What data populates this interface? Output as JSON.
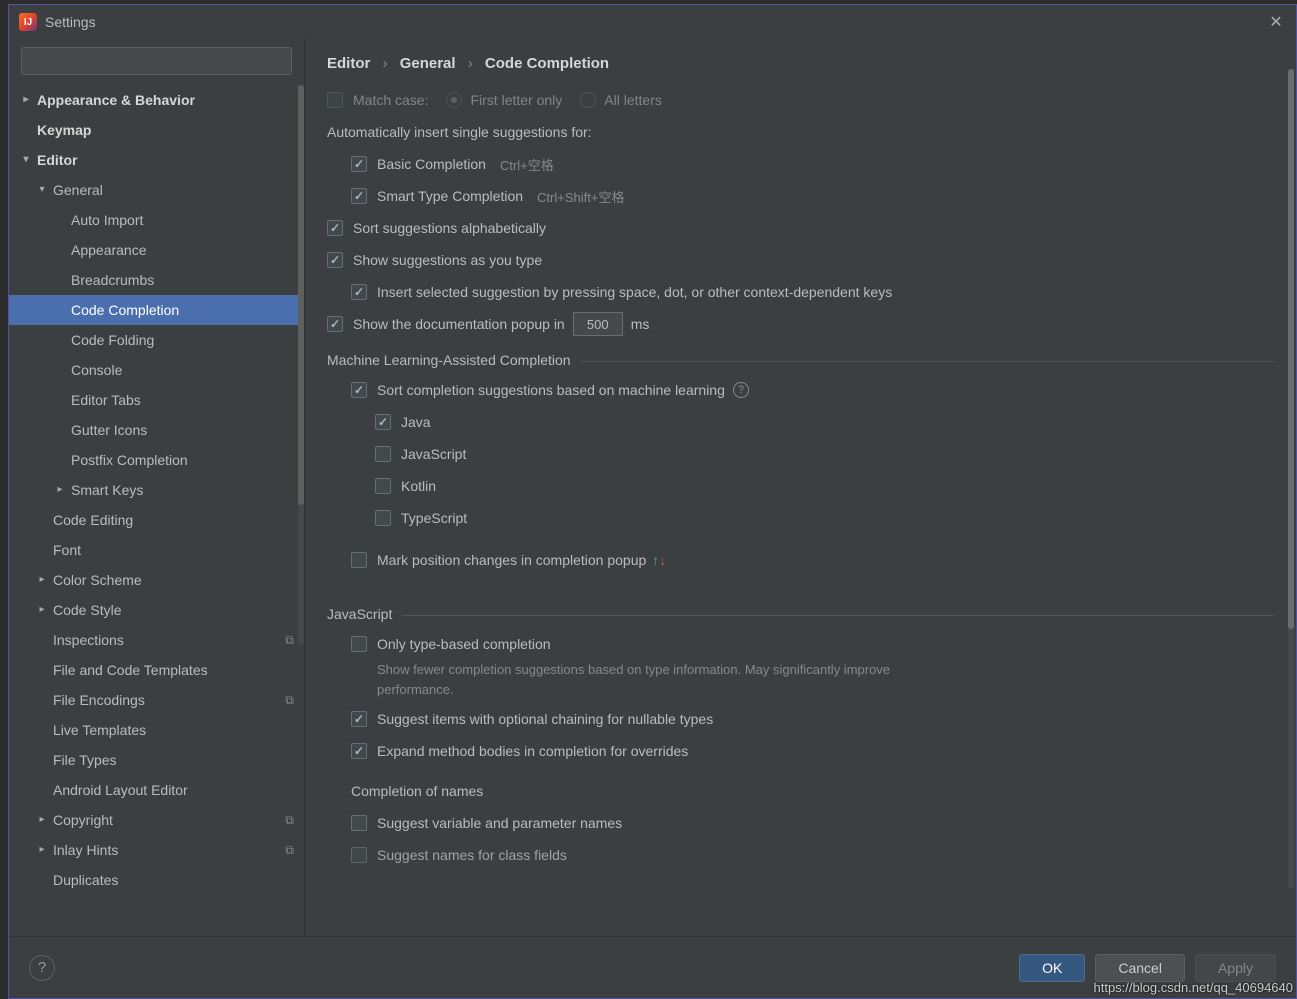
{
  "window": {
    "title": "Settings"
  },
  "breadcrumb": {
    "a": "Editor",
    "b": "General",
    "c": "Code Completion"
  },
  "sidebar": {
    "items": [
      {
        "label": "Appearance & Behavior",
        "bold": true,
        "chev": ">",
        "indent": 0
      },
      {
        "label": "Keymap",
        "bold": true,
        "indent": 0
      },
      {
        "label": "Editor",
        "bold": true,
        "chev": "v",
        "indent": 0
      },
      {
        "label": "General",
        "chev": "v",
        "indent": 1
      },
      {
        "label": "Auto Import",
        "indent": 2
      },
      {
        "label": "Appearance",
        "indent": 2
      },
      {
        "label": "Breadcrumbs",
        "indent": 2
      },
      {
        "label": "Code Completion",
        "indent": 2,
        "selected": true
      },
      {
        "label": "Code Folding",
        "indent": 2
      },
      {
        "label": "Console",
        "indent": 2
      },
      {
        "label": "Editor Tabs",
        "indent": 2
      },
      {
        "label": "Gutter Icons",
        "indent": 2
      },
      {
        "label": "Postfix Completion",
        "indent": 2
      },
      {
        "label": "Smart Keys",
        "chev": ">",
        "indent": 2
      },
      {
        "label": "Code Editing",
        "indent": 1
      },
      {
        "label": "Font",
        "indent": 1
      },
      {
        "label": "Color Scheme",
        "chev": ">",
        "indent": 1
      },
      {
        "label": "Code Style",
        "chev": ">",
        "indent": 1
      },
      {
        "label": "Inspections",
        "indent": 1,
        "badge": true
      },
      {
        "label": "File and Code Templates",
        "indent": 1
      },
      {
        "label": "File Encodings",
        "indent": 1,
        "badge": true
      },
      {
        "label": "Live Templates",
        "indent": 1
      },
      {
        "label": "File Types",
        "indent": 1
      },
      {
        "label": "Android Layout Editor",
        "indent": 1
      },
      {
        "label": "Copyright",
        "chev": ">",
        "indent": 1,
        "badge": true
      },
      {
        "label": "Inlay Hints",
        "chev": ">",
        "indent": 1,
        "badge": true
      },
      {
        "label": "Duplicates",
        "indent": 1
      }
    ]
  },
  "opts": {
    "match_case": {
      "label": "Match case:",
      "checked": false
    },
    "first_letter": "First letter only",
    "all_letters": "All letters",
    "auto_insert_header": "Automatically insert single suggestions for:",
    "basic": {
      "label": "Basic Completion",
      "kbd": "Ctrl+空格",
      "checked": true
    },
    "smart": {
      "label": "Smart Type Completion",
      "kbd": "Ctrl+Shift+空格",
      "checked": true
    },
    "sort_alpha": {
      "label": "Sort suggestions alphabetically",
      "checked": true
    },
    "show_type": {
      "label": "Show suggestions as you type",
      "checked": true
    },
    "insert_key": {
      "label": "Insert selected suggestion by pressing space, dot, or other context-dependent keys",
      "checked": true
    },
    "doc_popup": {
      "label_pre": "Show the documentation popup in",
      "label_post": "ms",
      "value": "500",
      "checked": true
    },
    "ml_header": "Machine Learning-Assisted Completion",
    "ml_sort": {
      "label": "Sort completion suggestions based on machine learning",
      "checked": true
    },
    "java": {
      "label": "Java",
      "checked": true
    },
    "javascript": {
      "label": "JavaScript",
      "checked": false
    },
    "kotlin": {
      "label": "Kotlin",
      "checked": false
    },
    "typescript": {
      "label": "TypeScript",
      "checked": false
    },
    "mark_pos": {
      "label": "Mark position changes in completion popup",
      "checked": false
    },
    "js_header": "JavaScript",
    "only_type": {
      "label": "Only type-based completion",
      "checked": false
    },
    "only_type_sub": "Show fewer completion suggestions based on type information. May significantly improve performance.",
    "suggest_chain": {
      "label": "Suggest items with optional chaining for nullable types",
      "checked": true
    },
    "expand_method": {
      "label": "Expand method bodies in completion for overrides",
      "checked": true
    },
    "completion_names": "Completion of names",
    "suggest_var": {
      "label": "Suggest variable and parameter names",
      "checked": false
    },
    "suggest_class": {
      "label": "Suggest names for class fields",
      "checked": false
    }
  },
  "footer": {
    "ok": "OK",
    "cancel": "Cancel",
    "apply": "Apply"
  },
  "watermark": "https://blog.csdn.net/qq_40694640"
}
